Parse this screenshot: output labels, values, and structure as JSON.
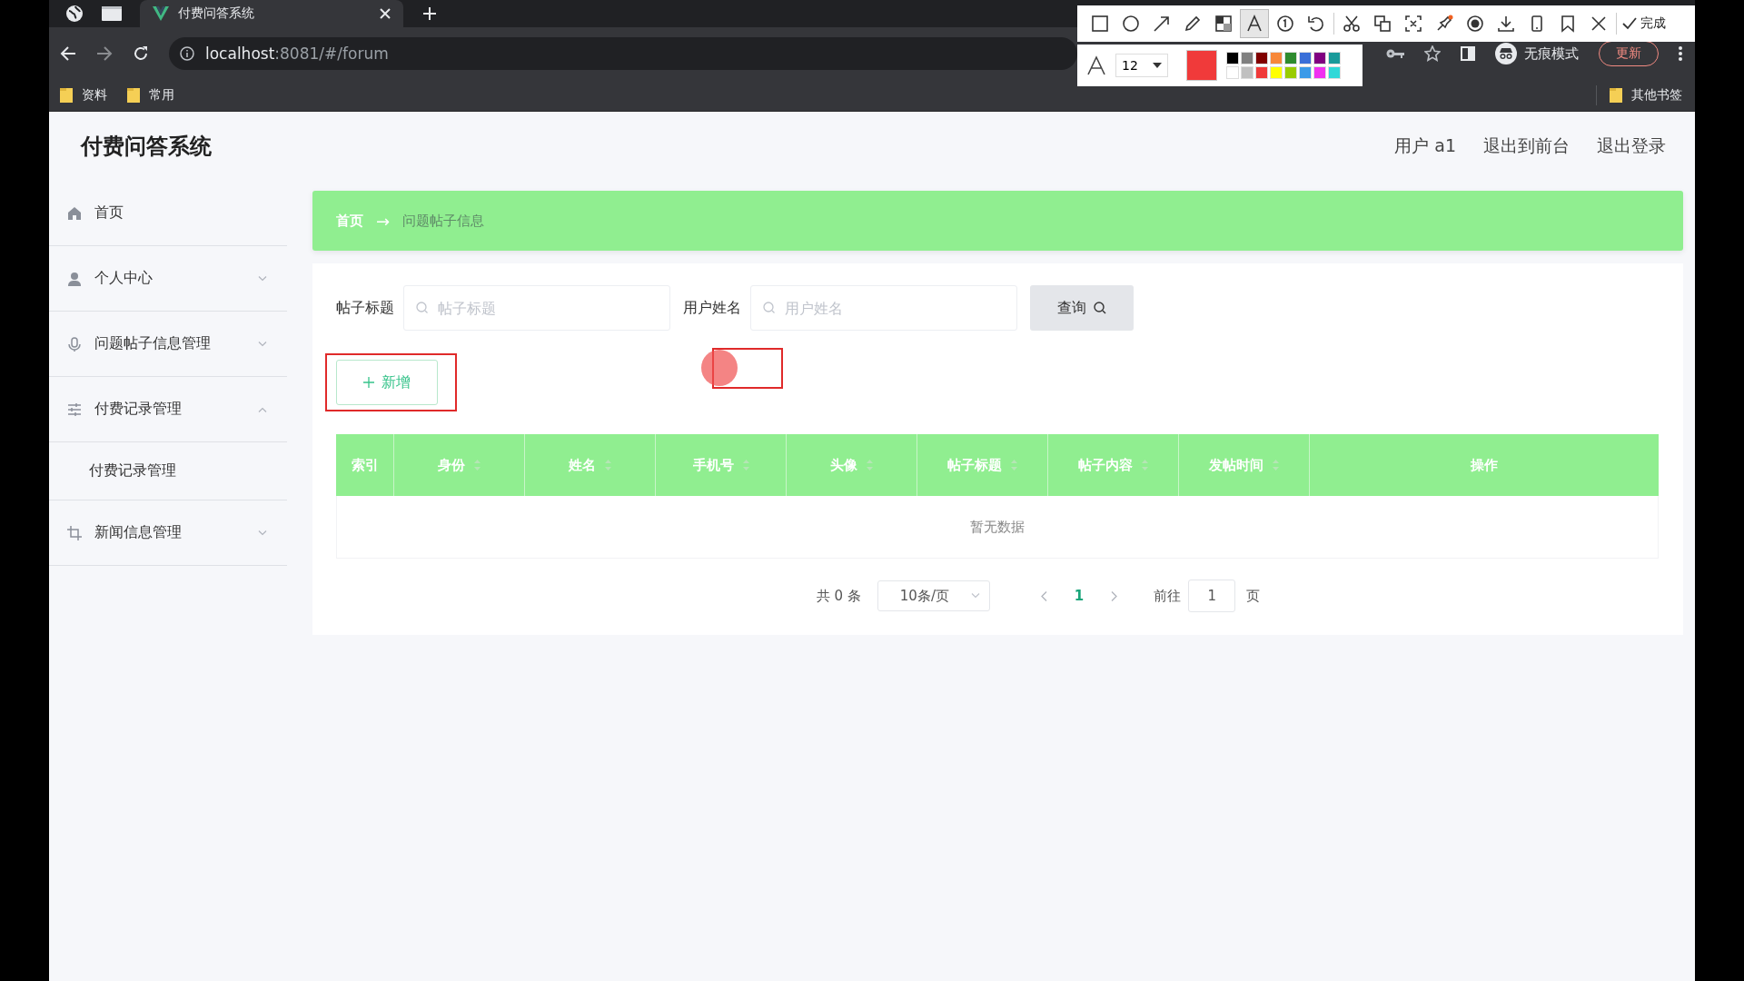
{
  "browser": {
    "tabs": [
      {
        "title": "付费问答系统"
      }
    ],
    "address": {
      "host": "localhost",
      "path": ":8081/#/forum"
    },
    "bookmarks": [
      "资料",
      "常用"
    ],
    "other_bookmarks": "其他书签",
    "incognito_label": "无痕模式",
    "update_button": "更新"
  },
  "annotation_toolbar": {
    "tools": [
      {
        "kind": "rect",
        "selected": false
      },
      {
        "kind": "circle",
        "selected": false
      },
      {
        "kind": "arrow",
        "selected": false
      },
      {
        "kind": "pencil",
        "selected": false
      },
      {
        "kind": "mosaic",
        "selected": false
      },
      {
        "kind": "text",
        "selected": true
      },
      {
        "kind": "number",
        "selected": false
      },
      {
        "kind": "undo",
        "selected": false
      },
      {
        "kind": "scissors",
        "selected": false
      },
      {
        "kind": "translate",
        "selected": false
      },
      {
        "kind": "scan",
        "selected": false
      },
      {
        "kind": "pin",
        "selected": false
      },
      {
        "kind": "record",
        "selected": false
      },
      {
        "kind": "download",
        "selected": false
      },
      {
        "kind": "phone",
        "selected": false
      },
      {
        "kind": "bookmark",
        "selected": false
      },
      {
        "kind": "close",
        "selected": false
      }
    ],
    "done_label": "完成",
    "font_size": "12",
    "palette": [
      {
        "color": "#000000"
      },
      {
        "color": "#808080"
      },
      {
        "color": "#800000"
      },
      {
        "color": "#f7883a"
      },
      {
        "color": "#2e8b2e"
      },
      {
        "color": "#3a6fd8"
      },
      {
        "color": "#800080"
      },
      {
        "color": "#1a9a9a"
      },
      {
        "color": "#ffffff"
      },
      {
        "color": "#c0c0c0"
      },
      {
        "color": "#f03a3a"
      },
      {
        "color": "#ffff00"
      },
      {
        "color": "#99cc00"
      },
      {
        "color": "#3a9ae8"
      },
      {
        "color": "#f030f0"
      },
      {
        "color": "#30d8d8"
      }
    ]
  },
  "app": {
    "title": "付费问答系统",
    "user_links": [
      "用户 a1",
      "退出到前台",
      "退出登录"
    ],
    "sidebar": [
      {
        "kind": "link",
        "label": "首页"
      },
      {
        "kind": "menu",
        "label": "个人中心",
        "expanded": false
      },
      {
        "kind": "menu",
        "label": "问题帖子信息管理",
        "expanded": false
      },
      {
        "kind": "menu",
        "label": "付费记录管理",
        "expanded": true,
        "children": [
          {
            "label": "付费记录管理"
          }
        ]
      },
      {
        "kind": "menu",
        "label": "新闻信息管理",
        "expanded": false
      }
    ],
    "breadcrumb": {
      "home": "首页",
      "separator": "→",
      "current": "问题帖子信息"
    },
    "search_fields": [
      {
        "label": "帖子标题",
        "placeholder": "帖子标题"
      },
      {
        "label": "用户姓名",
        "placeholder": "用户姓名"
      }
    ],
    "query_button": "查询",
    "add_button": "新增",
    "table": {
      "columns": [
        {
          "label": "索引",
          "sortable": false
        },
        {
          "label": "身份",
          "sortable": true
        },
        {
          "label": "姓名",
          "sortable": true
        },
        {
          "label": "手机号",
          "sortable": true
        },
        {
          "label": "头像",
          "sortable": true
        },
        {
          "label": "帖子标题",
          "sortable": true
        },
        {
          "label": "帖子内容",
          "sortable": true
        },
        {
          "label": "发帖时间",
          "sortable": true
        },
        {
          "label": "操作",
          "sortable": false
        }
      ],
      "empty_text": "暂无数据"
    },
    "pagination": {
      "total": "共 0 条",
      "page_size": "10条/页",
      "pages": [
        {
          "label": "1",
          "selected": true
        }
      ],
      "goto_label": "前往",
      "goto_value": "1",
      "page_suffix": "页"
    }
  }
}
